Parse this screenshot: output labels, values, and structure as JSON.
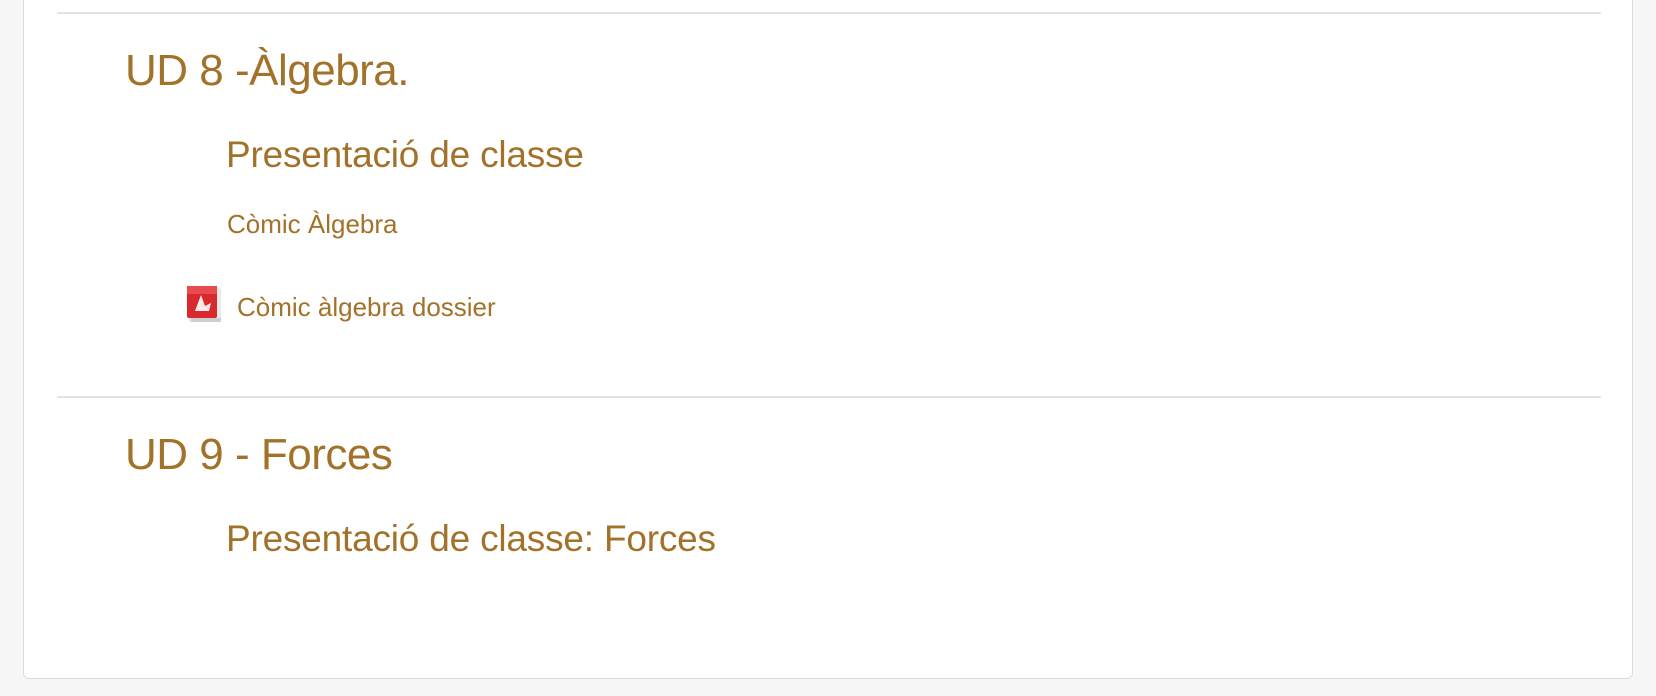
{
  "sections": [
    {
      "title": "UD 8 -Àlgebra.",
      "subtitle": "Presentació de classe",
      "label": "Còmic Àlgebra",
      "resource": {
        "icon": "pdf-icon",
        "label": "Còmic àlgebra dossier"
      }
    },
    {
      "title": "UD 9 - Forces",
      "subtitle": "Presentació de classe: Forces"
    }
  ],
  "colors": {
    "link": "#a2722a",
    "divider": "#e3e3e3",
    "pdf_red": "#d8292f"
  }
}
